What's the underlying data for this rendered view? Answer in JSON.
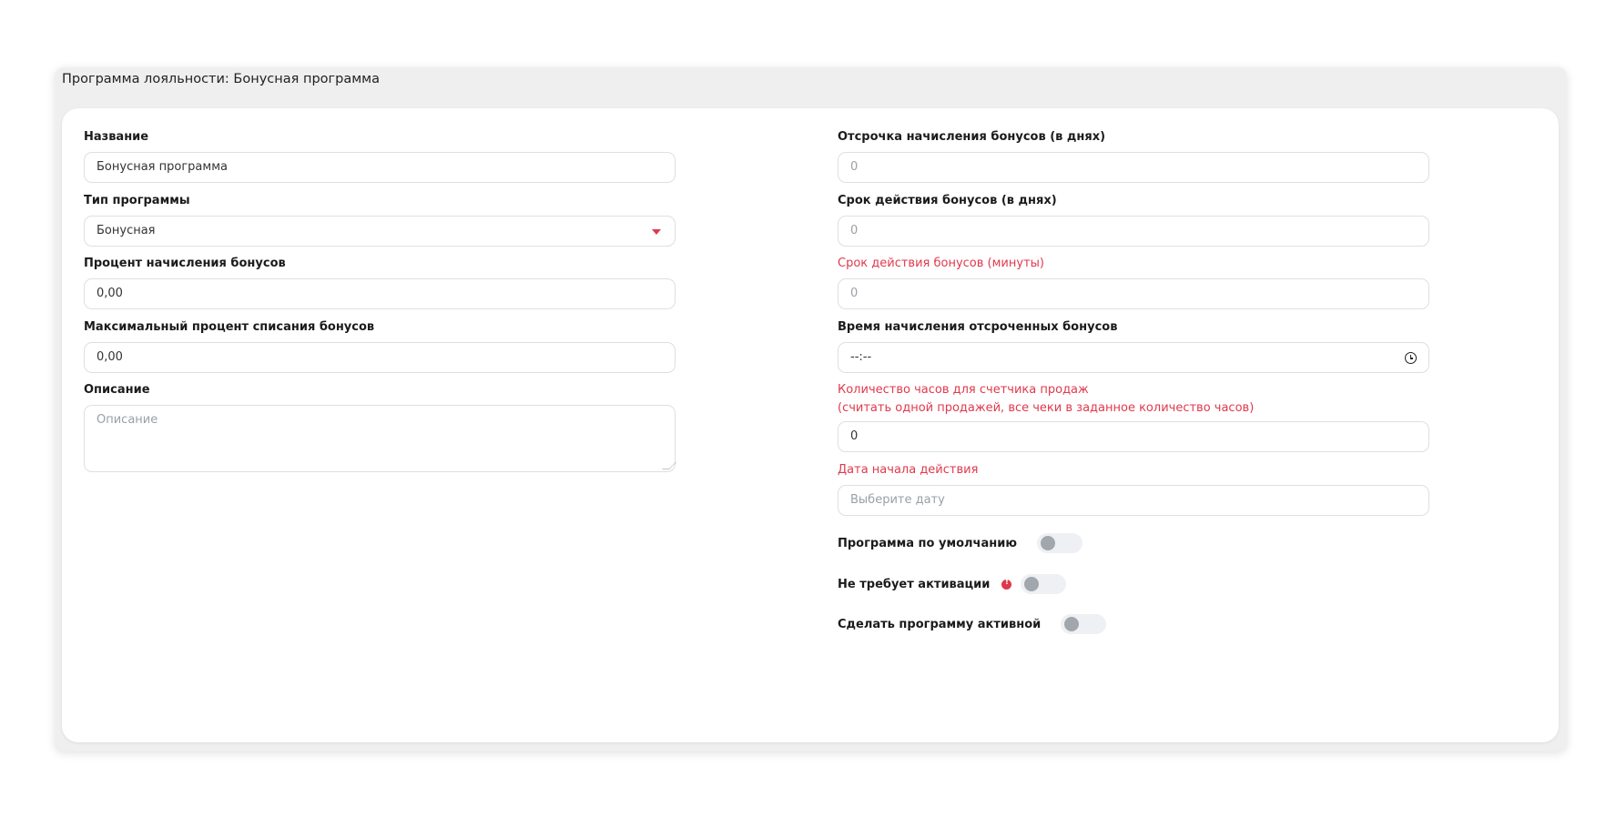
{
  "page": {
    "title": "Программа лояльности: Бонусная программа"
  },
  "left": {
    "name": {
      "label": "Название",
      "value": "Бонусная программа"
    },
    "program_type": {
      "label": "Тип программы",
      "value": "Бонусная"
    },
    "accrual_percent": {
      "label": "Процент начисления бонусов",
      "value": "0,00"
    },
    "max_writeoff_percent": {
      "label": "Максимальный процент списания бонусов",
      "value": "0,00"
    },
    "description": {
      "label": "Описание",
      "placeholder": "Описание"
    }
  },
  "right": {
    "accrual_delay_days": {
      "label": "Отсрочка начисления бонусов (в днях)",
      "placeholder": "0"
    },
    "validity_days": {
      "label": "Срок действия бонусов (в днях)",
      "placeholder": "0"
    },
    "validity_minutes": {
      "label": "Срок действия бонусов (минуты)",
      "placeholder": "0"
    },
    "deferred_accrual_time": {
      "label": "Время начисления отсроченных бонусов",
      "value": "--:--"
    },
    "sales_counter_hours": {
      "label_line1": "Количество часов для счетчика продаж",
      "label_line2": "(считать одной продажей, все чеки в заданное количество часов)",
      "value": "0"
    },
    "start_date": {
      "label": "Дата начала действия",
      "placeholder": "Выберите дату"
    }
  },
  "toggles": {
    "default_program": {
      "label": "Программа по умолчанию",
      "on": false
    },
    "no_activation": {
      "label": "Не требует активации",
      "on": false
    },
    "make_active": {
      "label": "Сделать программу активной",
      "on": false
    }
  },
  "colors": {
    "accent_red": "#e0394d",
    "outer_bg": "#efefef",
    "card_bg": "#ffffff",
    "toggle_track": "#eef0f4",
    "toggle_knob": "#a2a7ae"
  }
}
